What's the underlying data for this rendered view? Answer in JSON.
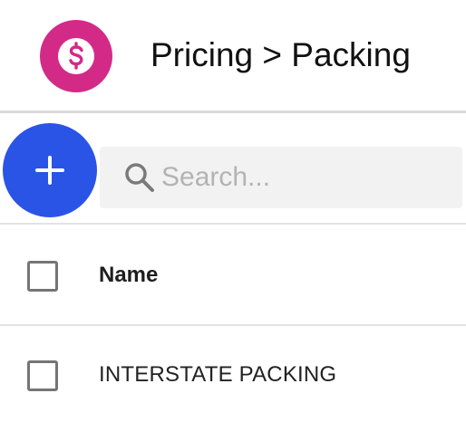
{
  "header": {
    "title": "Pricing > Packing",
    "logo_icon": "dollar-circle-icon",
    "logo_color": "#d42a87"
  },
  "toolbar": {
    "add_icon": "plus-icon",
    "add_color": "#2a54e6",
    "search": {
      "placeholder": "Search...",
      "value": "",
      "icon": "search-icon"
    }
  },
  "table": {
    "columns": [
      "Name"
    ],
    "rows": [
      {
        "name": "INTERSTATE PACKING",
        "checked": false
      }
    ]
  }
}
